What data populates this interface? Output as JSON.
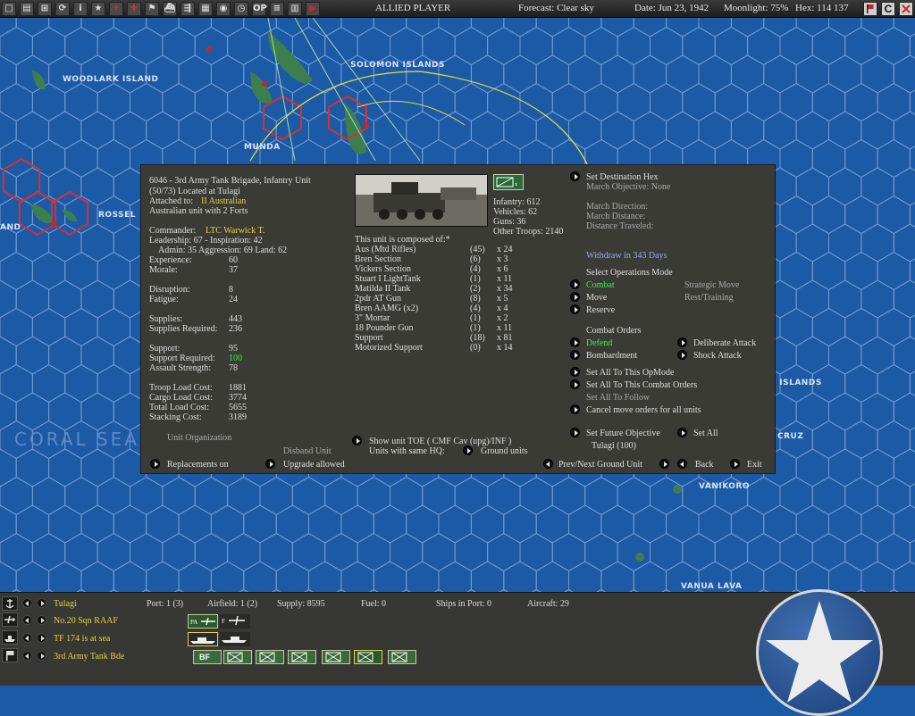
{
  "topbar": {
    "player": "ALLIED PLAYER",
    "forecast": "Forecast: Clear sky",
    "date": "Date: Jun 23, 1942",
    "moonlight": "Moonlight: 75%",
    "hex": "Hex: 114 137",
    "icons": [
      "screen-icon",
      "report-icon",
      "sub-icon",
      "cycle-icon",
      "info-icon",
      "star-icon",
      "plane-icon",
      "medic-icon",
      "flag-icon",
      "ship-icon",
      "train-icon",
      "map-icon",
      "globe-icon",
      "clock-icon",
      "op-icon",
      "list-icon",
      "chart-icon",
      "end-turn-icon"
    ],
    "right_icons": [
      "flag-icon",
      "c-icon",
      "x-icon"
    ],
    "op_label": "OP"
  },
  "map_labels": {
    "solomon": "SOLOMON ISLANDS",
    "woodlark": "WOODLARK ISLAND",
    "munda": "MUNDA",
    "rossel": "ROSSEL",
    "and": "AND",
    "coral": "CORAL SEA",
    "islands": "F ISLANDS",
    "cruz": "CRUZ",
    "vanikoro": "VANIKORO",
    "vanua": "VANUA LAVA"
  },
  "unit": {
    "title": "6046 - 3rd Army Tank Brigade, Infantry Unit",
    "location": "(50/73) Located at Tulagi",
    "attached_label": "Attached to:",
    "attached_value": "II Australian",
    "forts": "Australian unit with 2 Forts",
    "commander_label": "Commander:",
    "commander_value": "LTC Warwick T.",
    "leadership": "Leadership: 67 - Inspiration: 42",
    "admin": "Admin: 35  Aggression: 69  Land: 62",
    "stats": [
      {
        "label": "Experience:",
        "value": "60"
      },
      {
        "label": "Morale:",
        "value": "37"
      },
      {
        "label": "Disruption:",
        "value": "8"
      },
      {
        "label": "Fatigue:",
        "value": "24"
      },
      {
        "label": "Supplies:",
        "value": "443"
      },
      {
        "label": "Supplies Required:",
        "value": "236"
      },
      {
        "label": "Support:",
        "value": "95"
      },
      {
        "label": "Support Required:",
        "value": "100"
      },
      {
        "label": "Assault Strength:",
        "value": "78"
      },
      {
        "label": "Troop Load Cost:",
        "value": "1881"
      },
      {
        "label": "Cargo Load Cost:",
        "value": "3774"
      },
      {
        "label": "Total Load Cost:",
        "value": "5655"
      },
      {
        "label": "Stacking Cost:",
        "value": "3189"
      }
    ],
    "unit_org": "Unit Organization",
    "disband": "Disband Unit",
    "replacements": "Replacements on",
    "upgrade": "Upgrade allowed"
  },
  "composition": {
    "header": "This unit is composed of:*",
    "infantry": "Infantry: 612",
    "vehicles": "Vehicles: 62",
    "guns": "Guns: 36",
    "other": "Other Troops: 2140",
    "rows": [
      {
        "name": "Aus (Mtd Rifles)",
        "n": "(45)",
        "x": "x 24"
      },
      {
        "name": "Bren Section",
        "n": "(6)",
        "x": "x 3"
      },
      {
        "name": "Vickers Section",
        "n": "(4)",
        "x": "x 6"
      },
      {
        "name": "Stuart I LightTank",
        "n": "(1)",
        "x": "x 11"
      },
      {
        "name": "Matilda II Tank",
        "n": "(2)",
        "x": "x 34"
      },
      {
        "name": "2pdr AT Gun",
        "n": "(8)",
        "x": "x 5"
      },
      {
        "name": "Bren AAMG (x2)",
        "n": "(4)",
        "x": "x 4"
      },
      {
        "name": "3\" Mortar",
        "n": "(1)",
        "x": "x 2"
      },
      {
        "name": "18 Pounder Gun",
        "n": "(1)",
        "x": "x 11"
      },
      {
        "name": "Support",
        "n": "(18)",
        "x": "x 81"
      },
      {
        "name": "Motorized Support",
        "n": "(0)",
        "x": "x 14"
      }
    ],
    "show_toe": "Show unit TOE ( CMF Cav (upg)/INF )",
    "same_hq": "Units with same HQ:",
    "ground_units": "Ground units",
    "prev_next": "Prev/Next Ground Unit",
    "back": "Back",
    "exit": "Exit"
  },
  "orders": {
    "set_dest": "Set Destination Hex",
    "march_obj": "March Objective: None",
    "march_dir": "March Direction:",
    "march_dist": "March Distance:",
    "dist_traveled": "Distance Traveled:",
    "withdraw": "Withdraw in 343 Days",
    "select_op": "Select Operations Mode",
    "combat": "Combat",
    "strategic": "Strategic Move",
    "move": "Move",
    "rest": "Rest/Training",
    "reserve": "Reserve",
    "combat_orders": "Combat Orders",
    "defend": "Defend",
    "deliberate": "Deliberate Attack",
    "bombard": "Bombardment",
    "shock": "Shock Attack",
    "set_all_opmode": "Set All To This OpMode",
    "set_all_combat": "Set All To This Combat Orders",
    "set_all_follow": "Set All To Follow",
    "cancel_move": "Cancel move orders for all units",
    "set_future": "Set Future Objective",
    "set_all": "Set All",
    "tulagi": "Tulagi (100)"
  },
  "bottom": {
    "base": "Tulagi",
    "port": "Port: 1 (3)",
    "airfield": "Airfield: 1 (2)",
    "supply": "Supply: 8595",
    "fuel": "Fuel: 0",
    "ships": "Ships in Port: 0",
    "aircraft": "Aircraft: 29",
    "squadron": "No.20 Sqn RAAF",
    "tf": "TF 174 is at sea",
    "ground": "3rd Army Tank Bde",
    "pa_label": "PA",
    "f_label": "F",
    "bf_label": "BF"
  },
  "colors": {
    "ocean": "#1d5aa6",
    "hexline": "#6f9bd4",
    "panel": "#3b3b36",
    "yellow": "#e3d24a",
    "green": "#40e84a",
    "blue": "#9aa6ea"
  }
}
